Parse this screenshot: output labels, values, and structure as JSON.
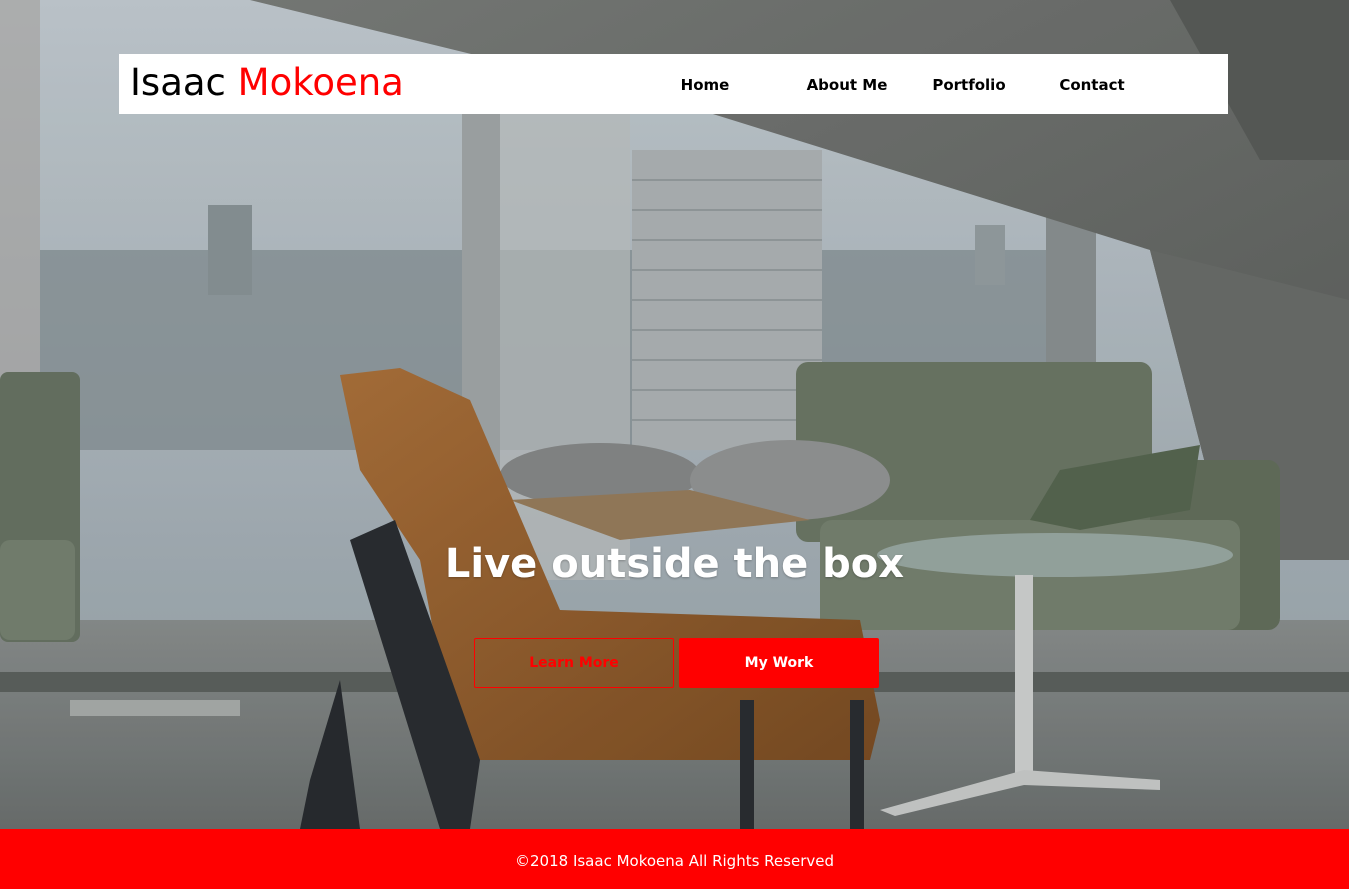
{
  "brand": {
    "first": "Isaac",
    "last": "Mokoena"
  },
  "nav": {
    "items": [
      {
        "label": "Home"
      },
      {
        "label": "About Me"
      },
      {
        "label": "Portfolio"
      },
      {
        "label": "Contact"
      }
    ]
  },
  "hero": {
    "headline": "Live outside the box",
    "primary_button": "Learn More",
    "secondary_button": "My Work"
  },
  "footer": {
    "text": "©2018 Isaac Mokoena All Rights Reserved"
  },
  "colors": {
    "accent": "#ff0000",
    "nav_bg": "#ffffff",
    "text_dark": "#000000"
  }
}
